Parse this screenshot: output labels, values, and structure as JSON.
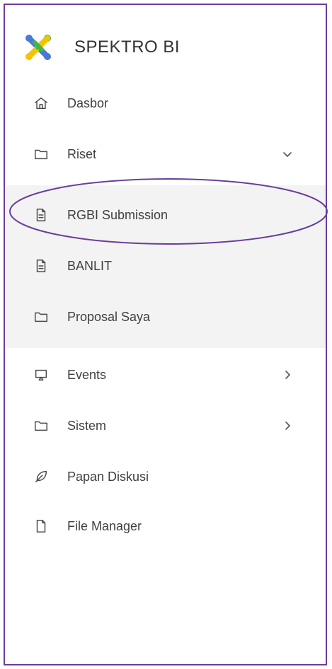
{
  "brand": {
    "name": "SPEKTRO BI",
    "logo_icon": "spektro-logo-icon",
    "colors": {
      "blue": "#4a78d6",
      "yellow": "#f5c400",
      "green": "#3db84a"
    }
  },
  "highlight_color": "#6a3d9a",
  "menu": [
    {
      "label": "Dasbor",
      "icon": "home-icon",
      "chevron": ""
    },
    {
      "label": "Riset",
      "icon": "folder-icon",
      "chevron": "down"
    },
    {
      "label": "RGBI Submission",
      "icon": "document-icon",
      "chevron": "",
      "submenu": true
    },
    {
      "label": "BANLIT",
      "icon": "document-icon",
      "chevron": "",
      "submenu": true
    },
    {
      "label": "Proposal Saya",
      "icon": "folder-icon",
      "chevron": "",
      "submenu": true
    },
    {
      "label": "Events",
      "icon": "presentation-icon",
      "chevron": "right"
    },
    {
      "label": "Sistem",
      "icon": "folder-icon",
      "chevron": "right"
    },
    {
      "label": "Papan Diskusi",
      "icon": "feather-icon",
      "chevron": ""
    },
    {
      "label": "File Manager",
      "icon": "file-icon",
      "chevron": ""
    }
  ]
}
